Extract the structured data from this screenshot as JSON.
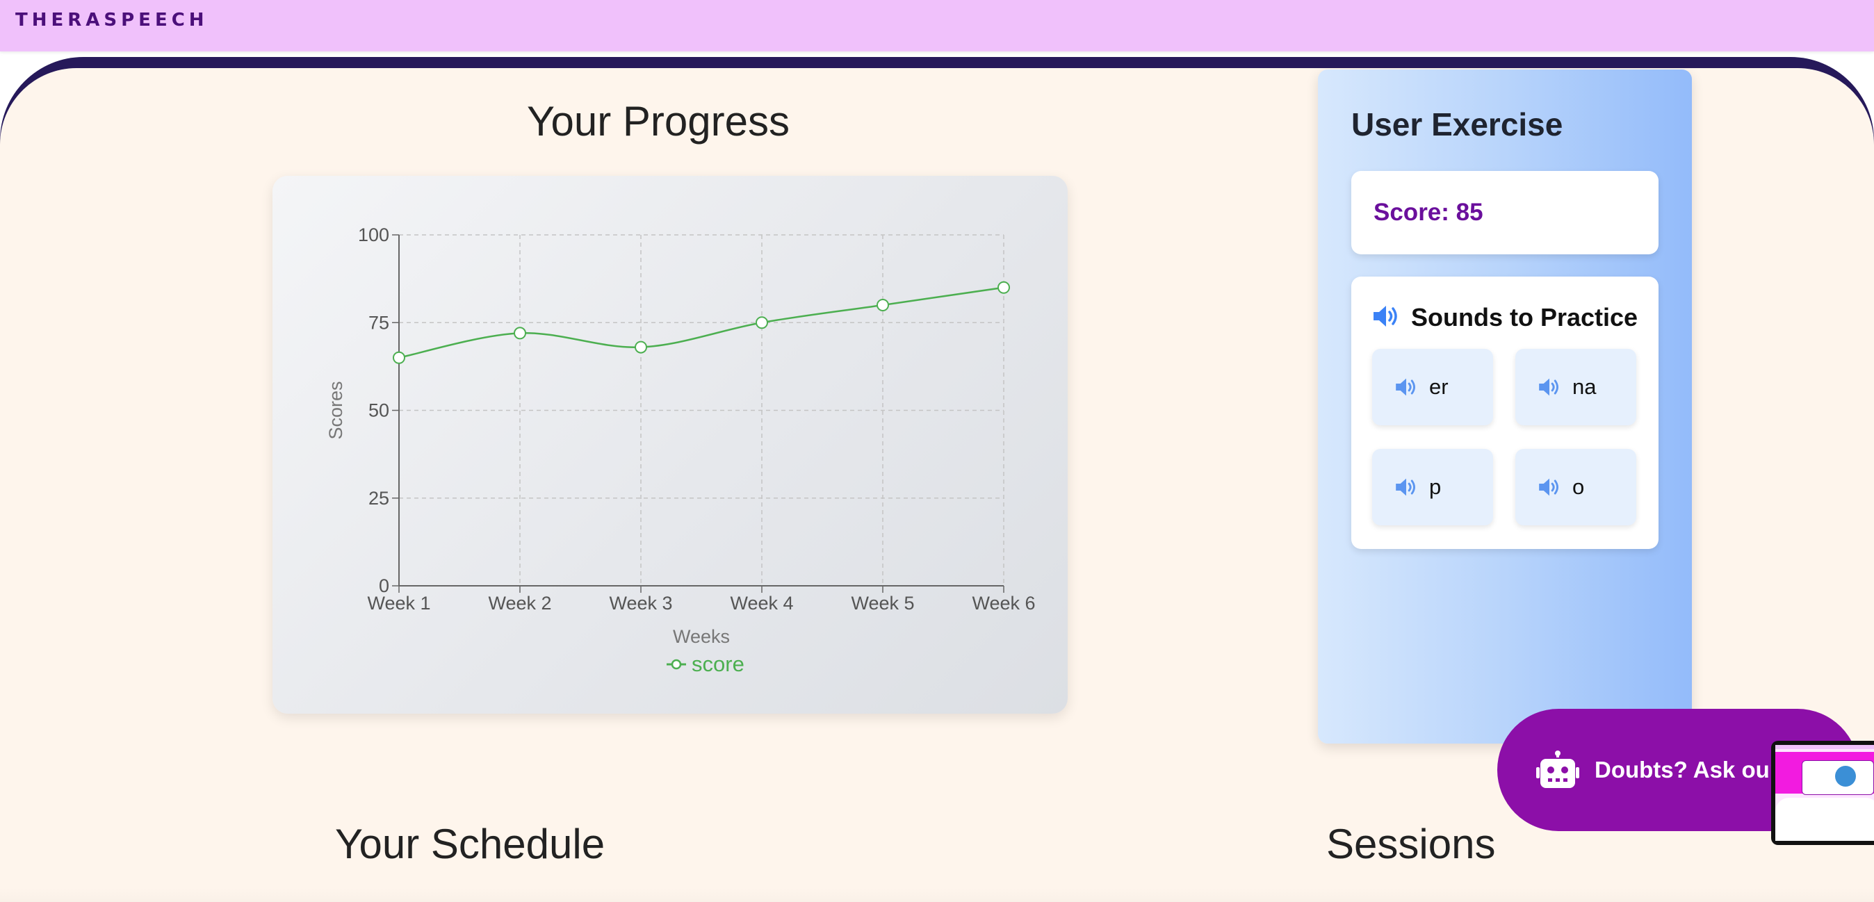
{
  "header": {
    "brand": "THERASPEECH"
  },
  "progress": {
    "title": "Your Progress"
  },
  "chart_data": {
    "type": "line",
    "x": [
      "Week 1",
      "Week 2",
      "Week 3",
      "Week 4",
      "Week 5",
      "Week 6"
    ],
    "series": [
      {
        "name": "score",
        "values": [
          65,
          72,
          68,
          75,
          80,
          85
        ],
        "color": "#4caf50"
      }
    ],
    "xlabel": "Weeks",
    "ylabel": "Scores",
    "yticks": [
      0,
      25,
      50,
      75,
      100
    ],
    "ylim": [
      0,
      100
    ],
    "grid": true,
    "legend": "bottom-center"
  },
  "exercise": {
    "title": "User Exercise",
    "score_label": "Score: 85",
    "sounds_title": "Sounds to Practice",
    "sounds": [
      "er",
      "na",
      "p",
      "o"
    ],
    "icon_color": "#3b82f6"
  },
  "chatbot": {
    "label": "Doubts? Ask our",
    "icon": "robot-icon"
  },
  "sections": {
    "schedule": "Your Schedule",
    "sessions": "Sessions"
  },
  "colors": {
    "header_bg": "#f0c1fb",
    "brand": "#4b0f7a",
    "frame": "#26195a",
    "page_bg": "#fef5ec",
    "accent_purple": "#8c0fa8",
    "score_text": "#6a0f9c"
  }
}
